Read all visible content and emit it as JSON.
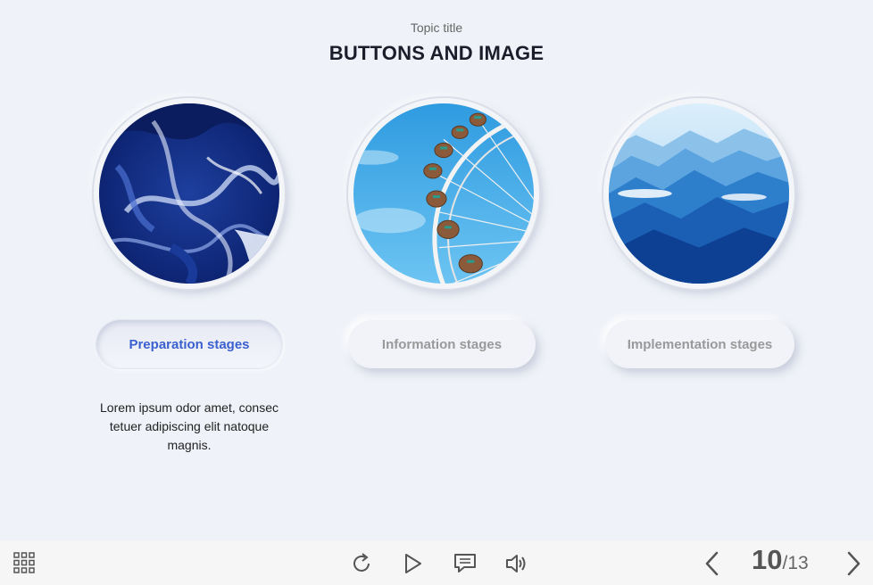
{
  "header": {
    "topic": "Topic title",
    "title": "BUTTONS AND IMAGE"
  },
  "cards": [
    {
      "image_name": "blue-ink-image",
      "button_label": "Preparation stages",
      "active": true
    },
    {
      "image_name": "ferris-wheel-image",
      "button_label": "Information stages",
      "active": false
    },
    {
      "image_name": "mountains-image",
      "button_label": "Implementation stages",
      "active": false
    }
  ],
  "description": "Lorem ipsum odor amet, consec tetuer adipiscing elit natoque magnis.",
  "toolbar": {
    "menu_icon": "grid-menu-icon",
    "replay_icon": "replay-icon",
    "play_icon": "play-icon",
    "notes_icon": "comment-icon",
    "audio_icon": "speaker-icon",
    "prev_icon": "chevron-left-icon",
    "next_icon": "chevron-right-icon"
  },
  "pagination": {
    "current": "10",
    "separator": "/",
    "total": "13"
  },
  "colors": {
    "background": "#eff2f8",
    "accent": "#3a5fcf",
    "inactive_text": "#999999",
    "toolbar": "#f6f6f7"
  }
}
